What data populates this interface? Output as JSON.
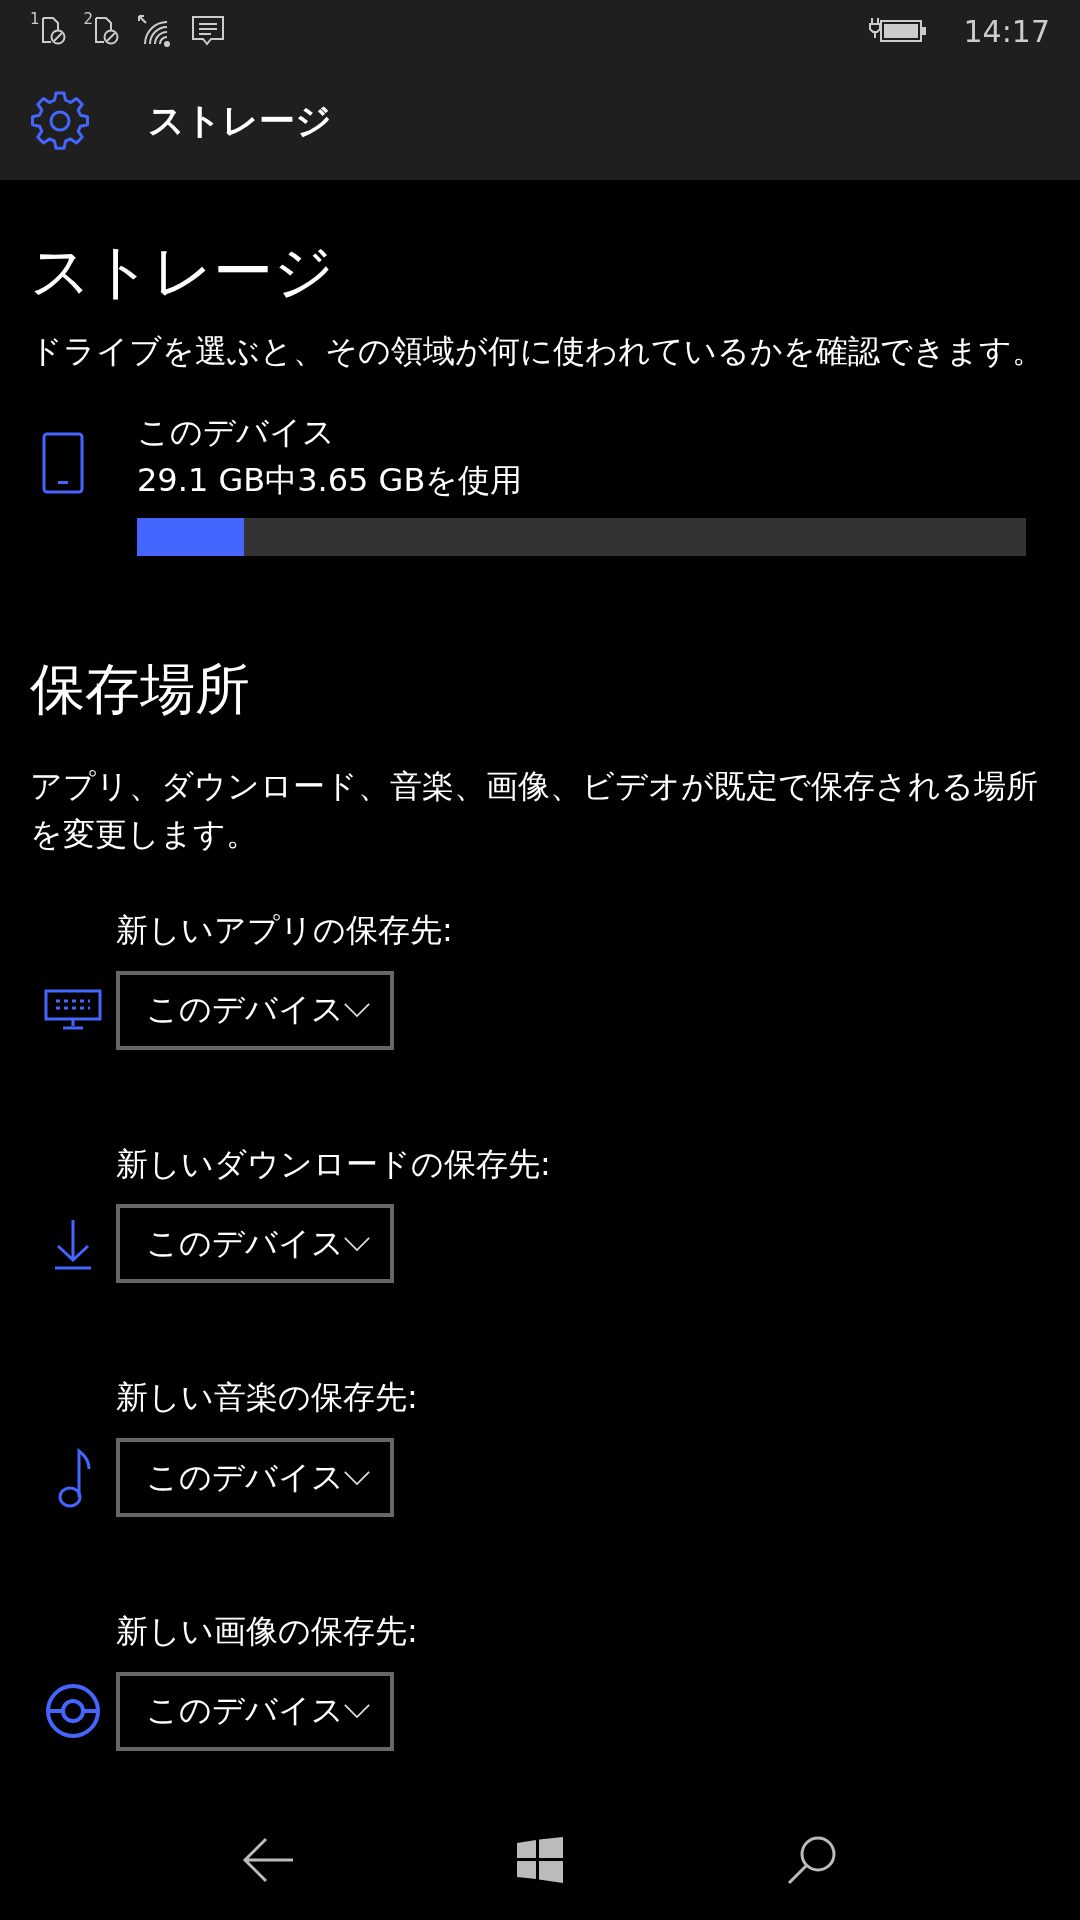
{
  "status_bar": {
    "sim_slots": [
      "1",
      "2"
    ],
    "time": "14:17"
  },
  "app_bar": {
    "title": "ストレージ"
  },
  "page": {
    "title": "ストレージ",
    "description": "ドライブを選ぶと、その領域が何に使われているかを確認できます。"
  },
  "drives": [
    {
      "name": "このデバイス",
      "usage": "29.1 GB中3.65 GBを使用",
      "level": 0.12
    }
  ],
  "save_locations": {
    "title": "保存場所",
    "description": "アプリ、ダウンロード、音楽、画像、ビデオが既定で保存される場所を変更します。",
    "items": [
      {
        "kind": "apps",
        "label": "新しいアプリの保存先:",
        "value": "このデバイス"
      },
      {
        "kind": "downloads",
        "label": "新しいダウンロードの保存先:",
        "value": "このデバイス"
      },
      {
        "kind": "music",
        "label": "新しい音楽の保存先:",
        "value": "このデバイス"
      },
      {
        "kind": "pictures",
        "label": "新しい画像の保存先:",
        "value": "このデバイス"
      }
    ]
  }
}
